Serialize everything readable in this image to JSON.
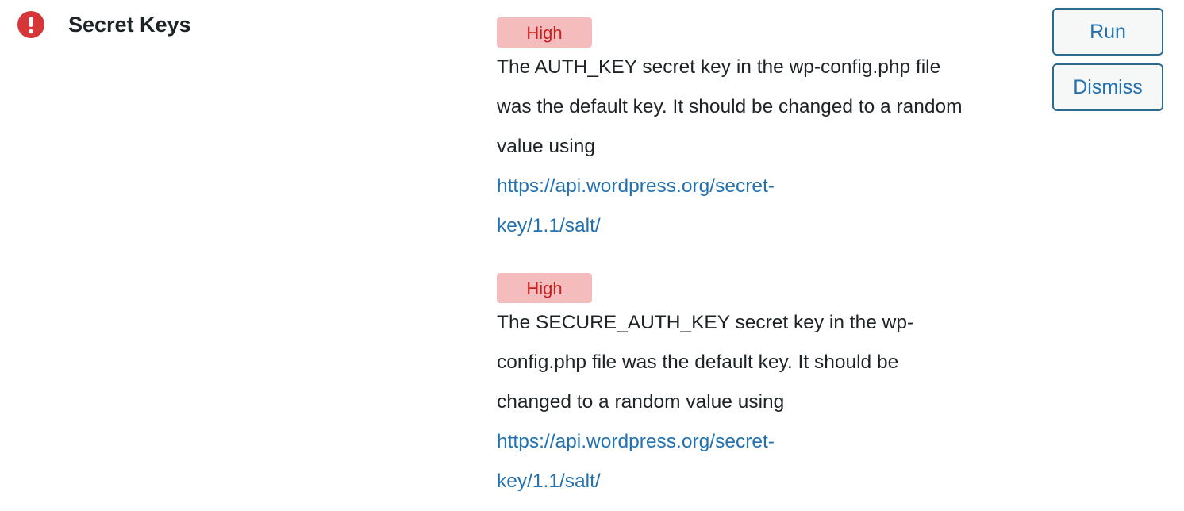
{
  "check": {
    "icon": "alert-circle-icon",
    "title": "Secret Keys",
    "icon_color": "#d63638"
  },
  "actions": {
    "run_label": "Run",
    "dismiss_label": "Dismiss"
  },
  "issues": [
    {
      "severity": "High",
      "lines": [
        "The AUTH_KEY secret key in the wp-config.php file",
        "was the default key. It should be changed to a random",
        "value using"
      ],
      "link_lines": [
        "https://api.wordpress.org/secret-",
        "key/1.1/salt/"
      ]
    },
    {
      "severity": "High",
      "lines": [
        "The SECURE_AUTH_KEY secret key in the wp-",
        "config.php file was the default key. It should be",
        "changed to a random value using"
      ],
      "link_lines": [
        "https://api.wordpress.org/secret-",
        "key/1.1/salt/"
      ]
    }
  ],
  "colors": {
    "badge_bg": "#f5bcbd",
    "badge_text": "#c5221f",
    "link": "#2271b1",
    "button_border": "#2c6a8f"
  }
}
